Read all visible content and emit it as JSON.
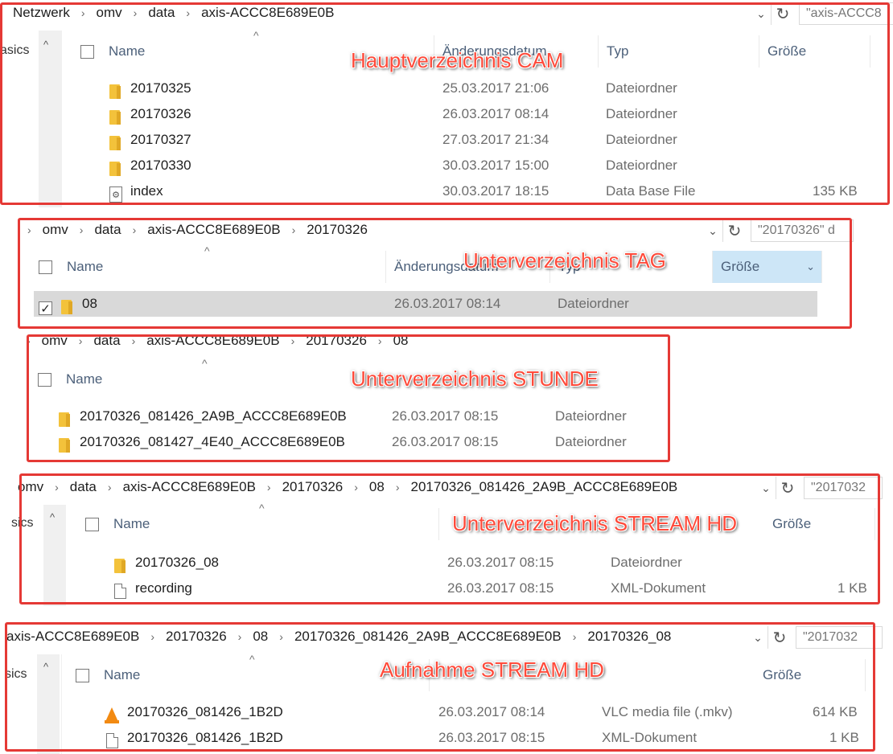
{
  "panel1": {
    "breadcrumb": [
      "Netzwerk",
      "omv",
      "data",
      "axis-ACCC8E689E0B"
    ],
    "search_placeholder": "\"axis-ACCC8",
    "nav_text": "asics",
    "columns": {
      "name": "Name",
      "date": "Änderungsdatum",
      "type": "Typ",
      "size": "Größe"
    },
    "label": "Hauptverzeichnis CAM",
    "rows": [
      {
        "name": "20170325",
        "date": "25.03.2017 21:06",
        "type": "Dateiordner",
        "size": "",
        "icon": "folder-icon"
      },
      {
        "name": "20170326",
        "date": "26.03.2017 08:14",
        "type": "Dateiordner",
        "size": "",
        "icon": "folder-icon"
      },
      {
        "name": "20170327",
        "date": "27.03.2017 21:34",
        "type": "Dateiordner",
        "size": "",
        "icon": "folder-icon"
      },
      {
        "name": "20170330",
        "date": "30.03.2017 15:00",
        "type": "Dateiordner",
        "size": "",
        "icon": "folder-icon"
      },
      {
        "name": "index",
        "date": "30.03.2017 18:15",
        "type": "Data Base File",
        "size": "135 KB",
        "icon": "database-file-icon"
      }
    ]
  },
  "panel2": {
    "breadcrumb": [
      "omv",
      "data",
      "axis-ACCC8E689E0B",
      "20170326"
    ],
    "search_placeholder": "\"20170326\" d",
    "columns": {
      "name": "Name",
      "date": "Änderungsdatum",
      "type": "Typ",
      "size": "Größe"
    },
    "label": "Unterverzeichnis TAG",
    "rows": [
      {
        "name": "08",
        "date": "26.03.2017 08:14",
        "type": "Dateiordner",
        "size": "",
        "icon": "folder-icon",
        "checked": "✓"
      }
    ]
  },
  "panel3": {
    "breadcrumb": [
      "omv",
      "data",
      "axis-ACCC8E689E0B",
      "20170326",
      "08"
    ],
    "columns": {
      "name": "Name"
    },
    "label": "Unterverzeichnis STUNDE",
    "rows": [
      {
        "name": "20170326_081426_2A9B_ACCC8E689E0B",
        "date": "26.03.2017 08:15",
        "type": "Dateiordner",
        "icon": "folder-icon"
      },
      {
        "name": "20170326_081427_4E40_ACCC8E689E0B",
        "date": "26.03.2017 08:15",
        "type": "Dateiordner",
        "icon": "folder-icon"
      }
    ]
  },
  "panel4": {
    "breadcrumb": [
      "omv",
      "data",
      "axis-ACCC8E689E0B",
      "20170326",
      "08",
      "20170326_081426_2A9B_ACCC8E689E0B"
    ],
    "search_placeholder": "\"2017032",
    "nav_text": "sics",
    "columns": {
      "name": "Name",
      "size": "Größe"
    },
    "label": "Unterverzeichnis STREAM HD",
    "rows": [
      {
        "name": "20170326_08",
        "date": "26.03.2017 08:15",
        "type": "Dateiordner",
        "size": "",
        "icon": "folder-icon"
      },
      {
        "name": "recording",
        "date": "26.03.2017 08:15",
        "type": "XML-Dokument",
        "size": "1 KB",
        "icon": "document-icon"
      }
    ]
  },
  "panel5": {
    "breadcrumb": [
      "axis-ACCC8E689E0B",
      "20170326",
      "08",
      "20170326_081426_2A9B_ACCC8E689E0B",
      "20170326_08"
    ],
    "search_placeholder": "\"2017032",
    "nav_text": "sics",
    "columns": {
      "name": "Name",
      "size": "Größe"
    },
    "label": "Aufnahme STREAM HD",
    "rows": [
      {
        "name": "20170326_081426_1B2D",
        "date": "26.03.2017 08:14",
        "type": "VLC media file (.mkv)",
        "size": "614 KB",
        "icon": "vlc-icon"
      },
      {
        "name": "20170326_081426_1B2D",
        "date": "26.03.2017 08:15",
        "type": "XML-Dokument",
        "size": "1 KB",
        "icon": "document-icon"
      }
    ]
  },
  "icons": {
    "separator": "›",
    "chevron": "⌄",
    "refresh": "↻",
    "sort_up": "^",
    "nav_up": "^"
  },
  "colors": {
    "annotation_red": "#e53935",
    "label_red": "#ff4a3a",
    "folder_yellow": "#f3c23b",
    "header_text": "#4c607a"
  }
}
